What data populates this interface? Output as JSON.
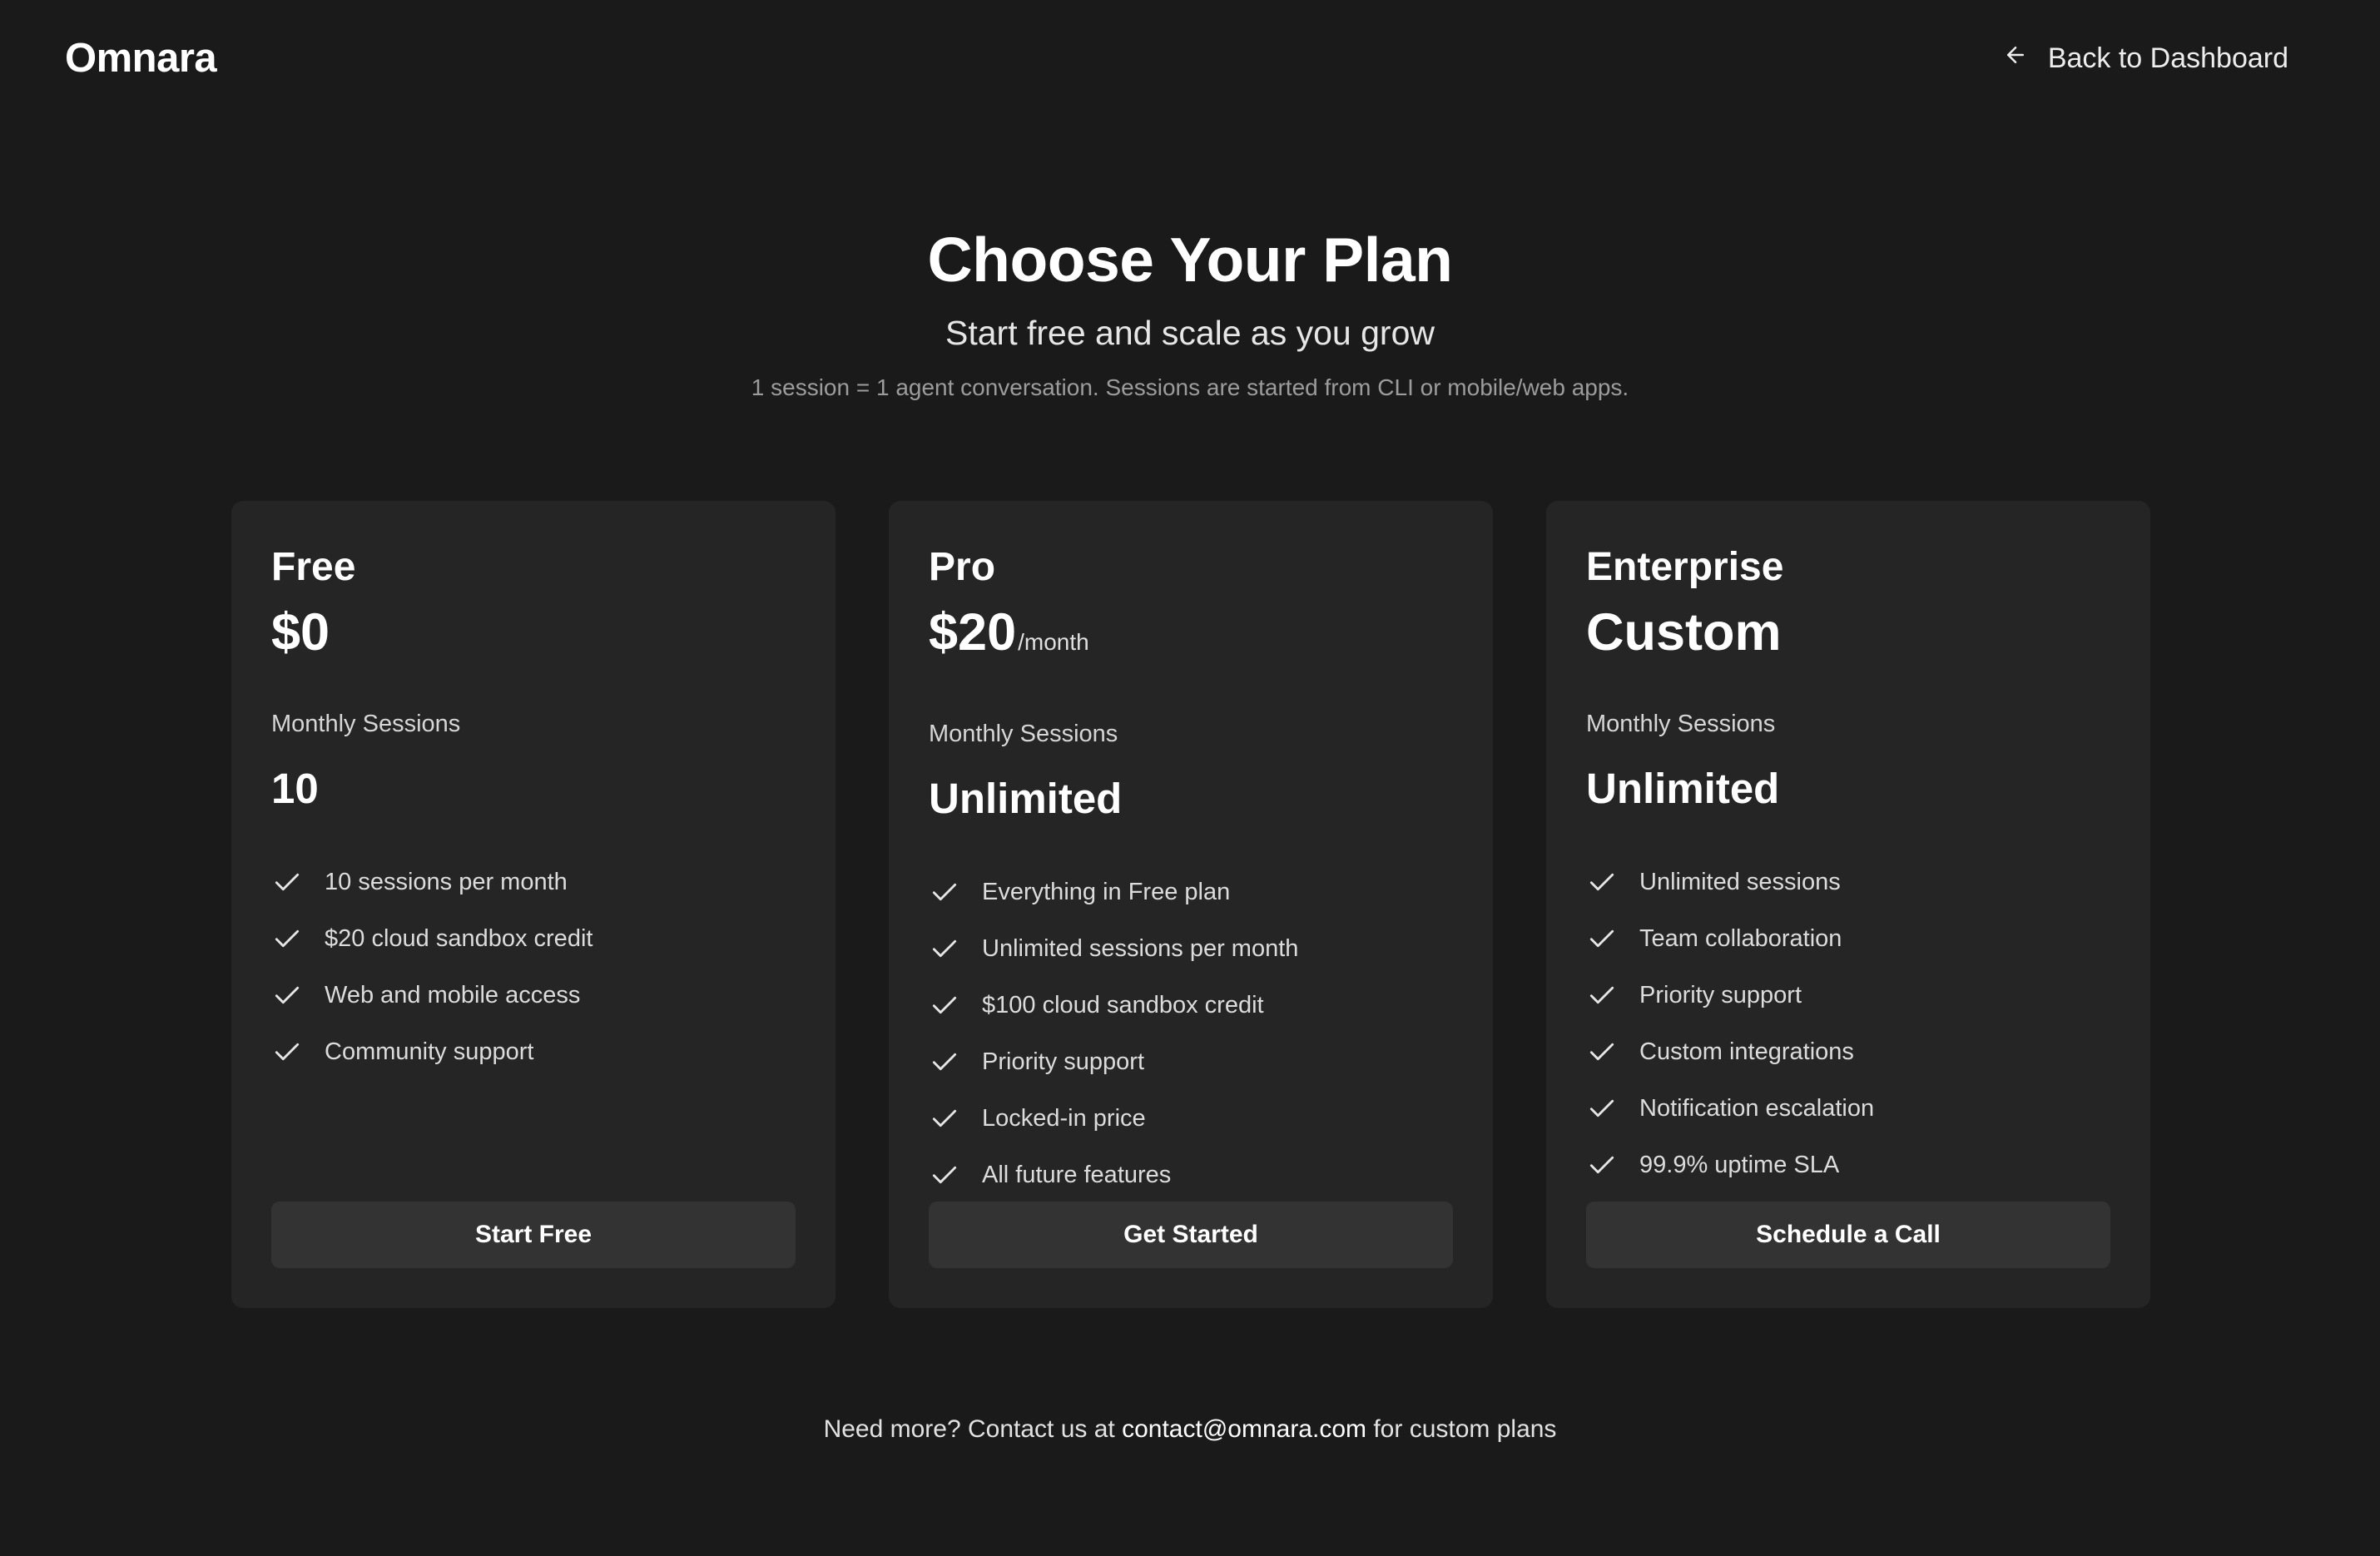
{
  "header": {
    "logo": "Omnara",
    "back_label": "Back to Dashboard"
  },
  "hero": {
    "title": "Choose Your Plan",
    "subtitle": "Start free and scale as you grow",
    "note": "1 session = 1 agent conversation. Sessions are started from CLI or mobile/web apps."
  },
  "plans": [
    {
      "name": "Free",
      "price": "$0",
      "period": "",
      "sessions_label": "Monthly Sessions",
      "sessions_value": "10",
      "features": [
        "10 sessions per month",
        "$20 cloud sandbox credit",
        "Web and mobile access",
        "Community support"
      ],
      "button_label": "Start Free"
    },
    {
      "name": "Pro",
      "price": "$20",
      "period": "/month",
      "sessions_label": "Monthly Sessions",
      "sessions_value": "Unlimited",
      "features": [
        "Everything in Free plan",
        "Unlimited sessions per month",
        "$100 cloud sandbox credit",
        "Priority support",
        "Locked-in price",
        "All future features"
      ],
      "button_label": "Get Started"
    },
    {
      "name": "Enterprise",
      "price": "Custom",
      "period": "",
      "sessions_label": "Monthly Sessions",
      "sessions_value": "Unlimited",
      "features": [
        "Unlimited sessions",
        "Team collaboration",
        "Priority support",
        "Custom integrations",
        "Notification escalation",
        "99.9% uptime SLA"
      ],
      "button_label": "Schedule a Call"
    }
  ],
  "footer": {
    "prefix": "Need more? Contact us at",
    "email": "contact@omnara.com",
    "suffix": "for custom plans"
  },
  "icons": {
    "back": "arrow-left-icon",
    "feature": "check-icon"
  },
  "colors": {
    "background": "#1a1a1a",
    "card": "#252525",
    "button": "#333333",
    "text": "#ffffff",
    "muted": "#9c9c9c"
  }
}
